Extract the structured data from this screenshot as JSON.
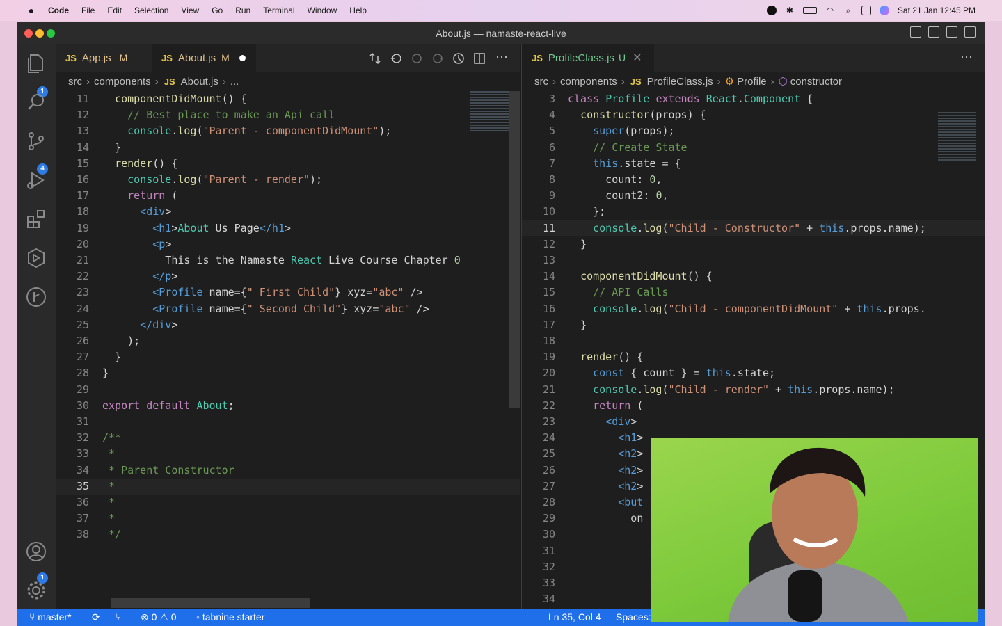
{
  "menubar": {
    "apple": "",
    "app": "Code",
    "items": [
      "File",
      "Edit",
      "Selection",
      "View",
      "Go",
      "Run",
      "Terminal",
      "Window",
      "Help"
    ],
    "datetime": "Sat 21 Jan  12:45 PM"
  },
  "window": {
    "title": "About.js — namaste-react-live"
  },
  "activity_badges": {
    "explorer": "1",
    "source_control": "4",
    "accounts": "1"
  },
  "left_pane": {
    "tabs": [
      {
        "label": "App.js",
        "status": "M"
      },
      {
        "label": "About.js",
        "status": "M"
      }
    ],
    "breadcrumb": [
      "src",
      "components",
      "About.js",
      "..."
    ],
    "lines": [
      {
        "n": "11",
        "t": "  componentDidMount() {"
      },
      {
        "n": "12",
        "t": "    // Best place to make an Api call"
      },
      {
        "n": "13",
        "t": "    console.log(\"Parent - componentDidMount\");"
      },
      {
        "n": "14",
        "t": "  }"
      },
      {
        "n": "15",
        "t": "  render() {"
      },
      {
        "n": "16",
        "t": "    console.log(\"Parent - render\");"
      },
      {
        "n": "17",
        "t": "    return ("
      },
      {
        "n": "18",
        "t": "      <div>"
      },
      {
        "n": "19",
        "t": "        <h1>About Us Page</h1>"
      },
      {
        "n": "20",
        "t": "        <p>"
      },
      {
        "n": "21",
        "t": "          This is the Namaste React Live Course Chapter 0"
      },
      {
        "n": "22",
        "t": "        </p>"
      },
      {
        "n": "23",
        "t": "        <Profile name={\" First Child\"} xyz=\"abc\" />"
      },
      {
        "n": "24",
        "t": "        <Profile name={\" Second Child\"} xyz=\"abc\" />"
      },
      {
        "n": "25",
        "t": "      </div>"
      },
      {
        "n": "26",
        "t": "    );"
      },
      {
        "n": "27",
        "t": "  }"
      },
      {
        "n": "28",
        "t": "}"
      },
      {
        "n": "29",
        "t": ""
      },
      {
        "n": "30",
        "t": "export default About;"
      },
      {
        "n": "31",
        "t": ""
      },
      {
        "n": "32",
        "t": "/**"
      },
      {
        "n": "33",
        "t": " *"
      },
      {
        "n": "34",
        "t": " * Parent Constructor"
      },
      {
        "n": "35",
        "t": " *"
      },
      {
        "n": "36",
        "t": " *"
      },
      {
        "n": "37",
        "t": " *"
      },
      {
        "n": "38",
        "t": " */"
      }
    ],
    "current_line": "35"
  },
  "right_pane": {
    "tabs": [
      {
        "label": "ProfileClass.js",
        "status": "U"
      }
    ],
    "breadcrumb": [
      "src",
      "components",
      "ProfileClass.js",
      "Profile",
      "constructor"
    ],
    "lines": [
      {
        "n": "3",
        "t": "class Profile extends React.Component {"
      },
      {
        "n": "4",
        "t": "  constructor(props) {"
      },
      {
        "n": "5",
        "t": "    super(props);"
      },
      {
        "n": "6",
        "t": "    // Create State"
      },
      {
        "n": "7",
        "t": "    this.state = {"
      },
      {
        "n": "8",
        "t": "      count: 0,"
      },
      {
        "n": "9",
        "t": "      count2: 0,"
      },
      {
        "n": "10",
        "t": "    };"
      },
      {
        "n": "11",
        "t": "    console.log(\"Child - Constructor\" + this.props.name);"
      },
      {
        "n": "12",
        "t": "  }"
      },
      {
        "n": "13",
        "t": ""
      },
      {
        "n": "14",
        "t": "  componentDidMount() {"
      },
      {
        "n": "15",
        "t": "    // API Calls"
      },
      {
        "n": "16",
        "t": "    console.log(\"Child - componentDidMount\" + this.props."
      },
      {
        "n": "17",
        "t": "  }"
      },
      {
        "n": "18",
        "t": ""
      },
      {
        "n": "19",
        "t": "  render() {"
      },
      {
        "n": "20",
        "t": "    const { count } = this.state;"
      },
      {
        "n": "21",
        "t": "    console.log(\"Child - render\" + this.props.name);"
      },
      {
        "n": "22",
        "t": "    return ("
      },
      {
        "n": "23",
        "t": "      <div>"
      },
      {
        "n": "24",
        "t": "        <h1>"
      },
      {
        "n": "25",
        "t": "        <h2>"
      },
      {
        "n": "26",
        "t": "        <h2>"
      },
      {
        "n": "27",
        "t": "        <h2>"
      },
      {
        "n": "28",
        "t": "        <but"
      },
      {
        "n": "29",
        "t": "          on"
      },
      {
        "n": "30",
        "t": ""
      },
      {
        "n": "31",
        "t": ""
      },
      {
        "n": "32",
        "t": ""
      },
      {
        "n": "33",
        "t": ""
      },
      {
        "n": "34",
        "t": ""
      }
    ],
    "current_line": "11"
  },
  "statusbar": {
    "branch": "master*",
    "errors": "0",
    "warnings": "0",
    "tabnine": "tabnine starter",
    "position": "Ln 35, Col 4",
    "spaces": "Spaces:"
  },
  "colors": {
    "accent": "#1f6feb",
    "js": "#e2c44b",
    "modified": "#e2c08d",
    "untracked": "#73c991"
  }
}
